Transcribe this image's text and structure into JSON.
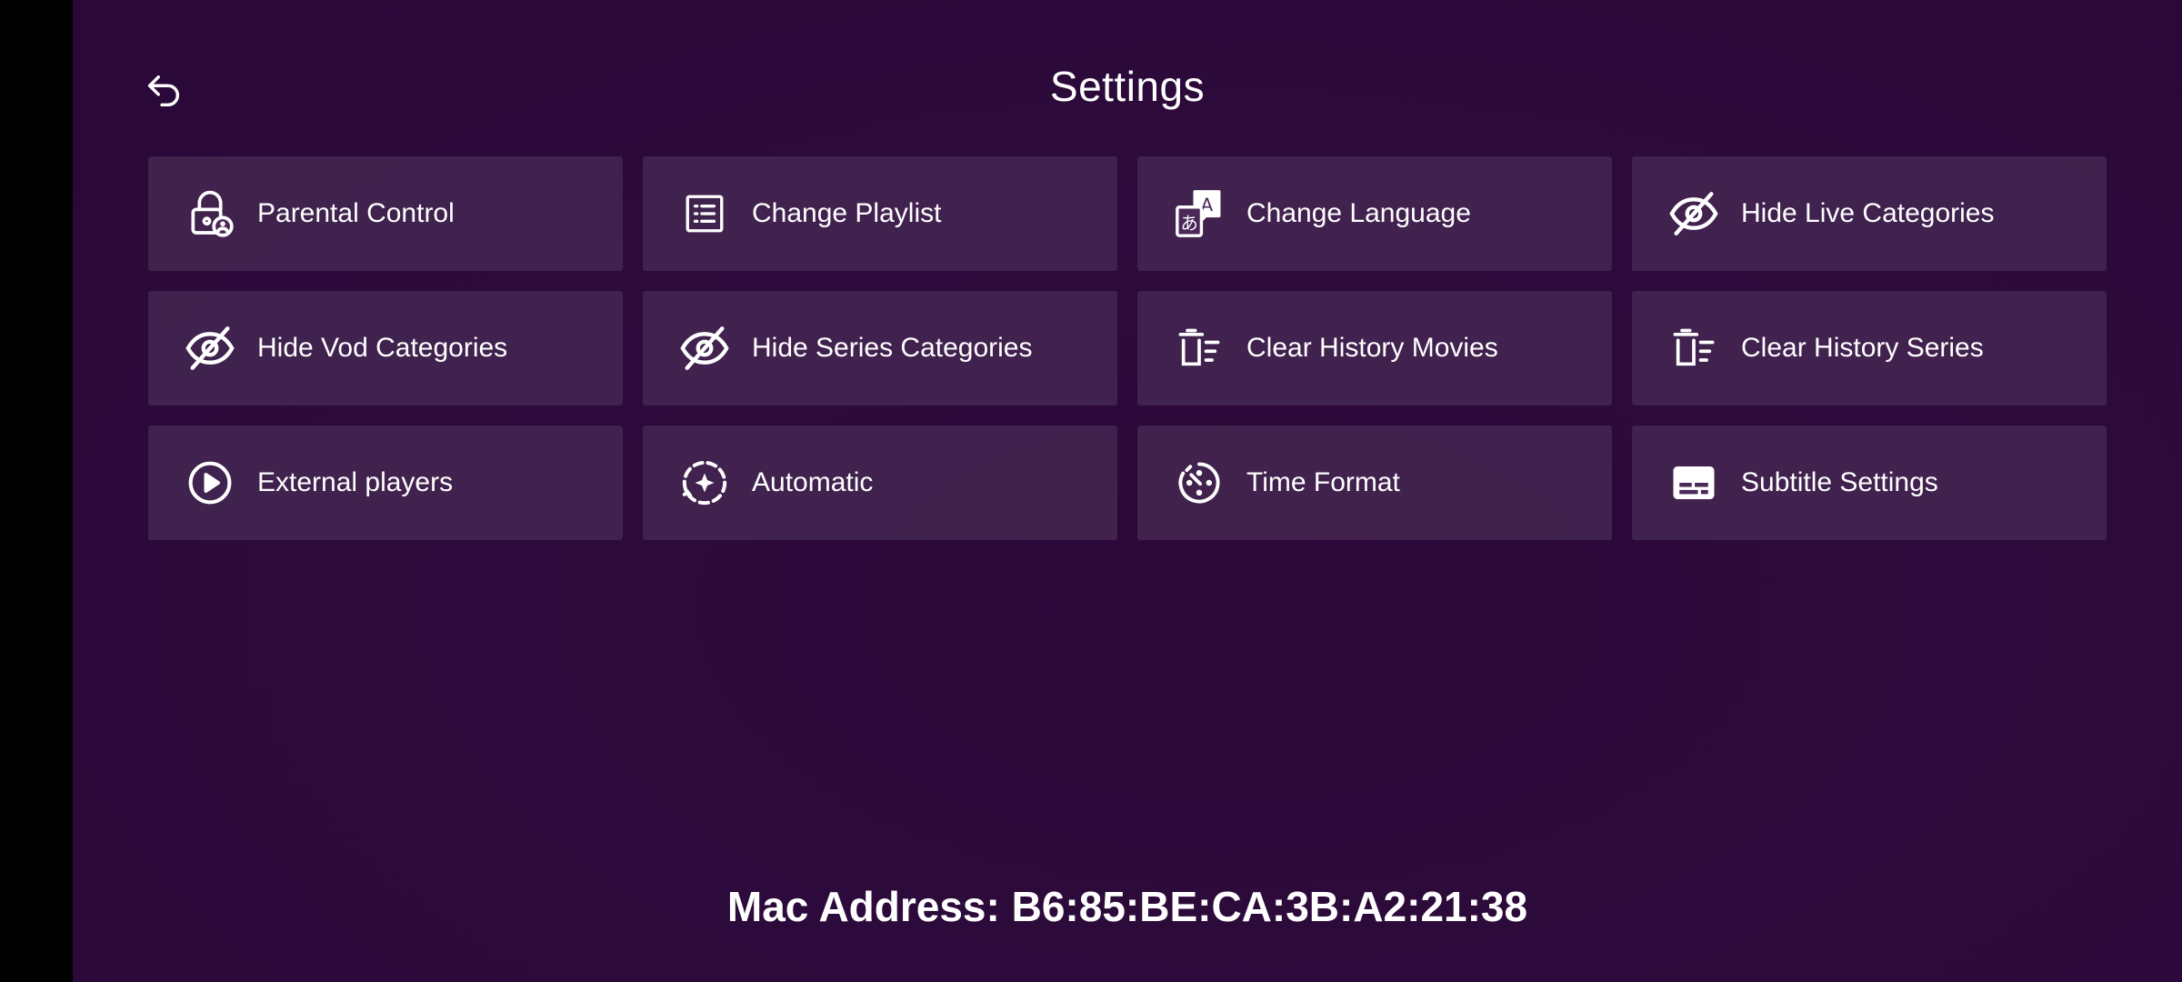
{
  "header": {
    "title": "Settings"
  },
  "tiles": [
    {
      "label": "Parental Control",
      "icon": "lock-user-icon"
    },
    {
      "label": "Change Playlist",
      "icon": "list-icon"
    },
    {
      "label": "Change Language",
      "icon": "translate-icon"
    },
    {
      "label": "Hide Live Categories",
      "icon": "eye-off-icon"
    },
    {
      "label": "Hide Vod Categories",
      "icon": "eye-off-icon"
    },
    {
      "label": "Hide Series Categories",
      "icon": "eye-off-icon"
    },
    {
      "label": "Clear History Movies",
      "icon": "delete-list-icon"
    },
    {
      "label": "Clear History Series",
      "icon": "delete-list-icon"
    },
    {
      "label": "External players",
      "icon": "play-circle-icon"
    },
    {
      "label": "Automatic",
      "icon": "auto-sync-icon"
    },
    {
      "label": "Time Format",
      "icon": "clock-dashed-icon"
    },
    {
      "label": "Subtitle Settings",
      "icon": "subtitles-icon"
    }
  ],
  "footer": {
    "mac_address": "Mac Address: B6:85:BE:CA:3B:A2:21:38"
  },
  "colors": {
    "background": "#2c0a3b",
    "tile": "#4a2858",
    "text": "#ffffff"
  }
}
